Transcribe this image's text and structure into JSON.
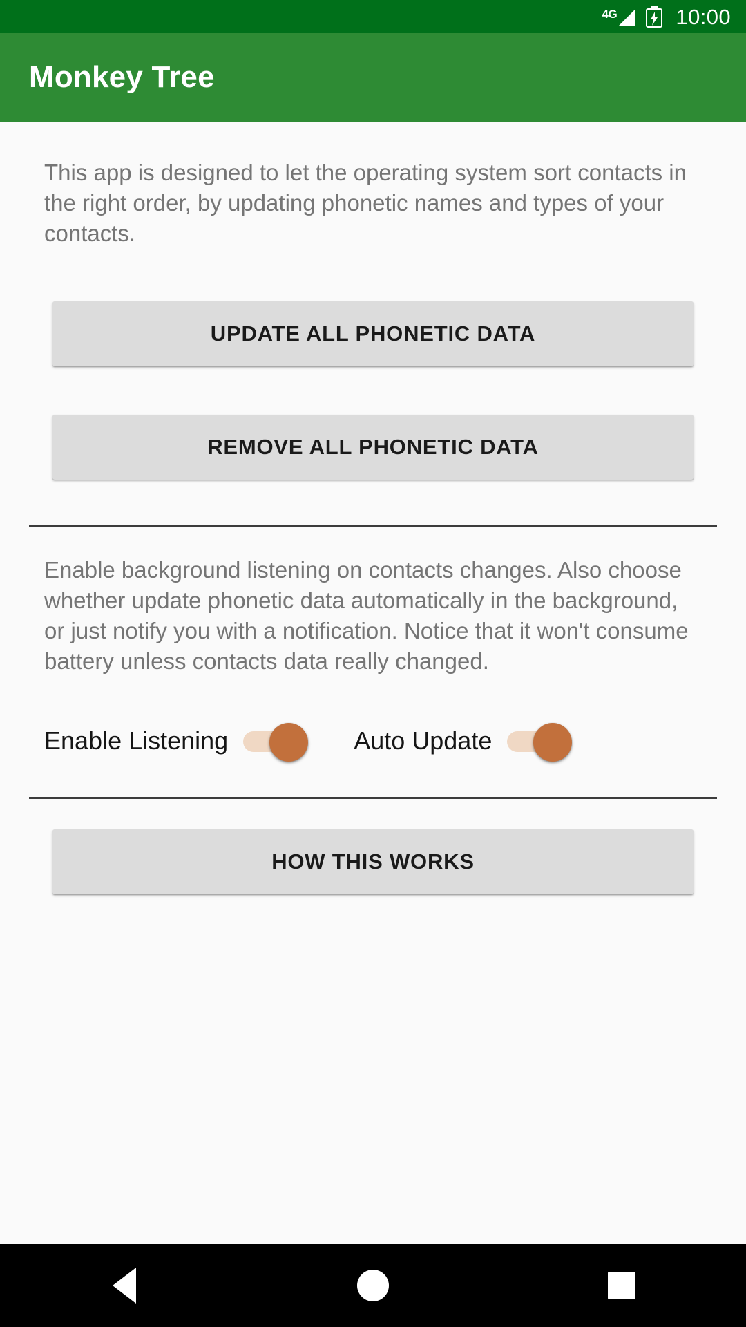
{
  "status_bar": {
    "network_label": "4G",
    "signal_icon": "signal-triangle-icon",
    "battery_icon": "battery-charging-icon",
    "time": "10:00",
    "background_color": "#00701a"
  },
  "app_bar": {
    "title": "Monkey Tree",
    "background_color": "#2e8b34",
    "text_color": "#ffffff"
  },
  "main": {
    "intro_paragraph": "This app is designed to let the operating system sort contacts in the right order, by updating phonetic names and types of your contacts.",
    "update_button_label": "UPDATE ALL PHONETIC DATA",
    "remove_button_label": "REMOVE ALL PHONETIC DATA",
    "background_paragraph": "Enable background listening on contacts changes. Also choose whether update phonetic data automatically in the background, or just notify you with a notification. Notice that it won't consume battery unless contacts data really changed.",
    "switches": [
      {
        "label": "Enable Listening",
        "state": "on"
      },
      {
        "label": "Auto Update",
        "state": "on"
      }
    ],
    "how_button_label": "HOW THIS WORKS",
    "button_color": "#dcdcdc",
    "switch_accent_color": "#c2703c",
    "switch_track_color": "#f0d8c4",
    "paragraph_text_color": "#757575"
  },
  "navigation_bar": {
    "back_icon": "back-triangle-icon",
    "home_icon": "home-circle-icon",
    "recents_icon": "recents-square-icon",
    "background_color": "#000000"
  }
}
